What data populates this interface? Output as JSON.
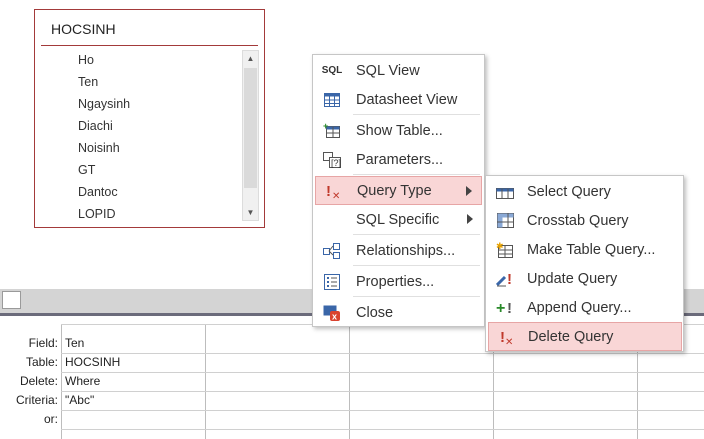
{
  "table": {
    "title": "HOCSINH",
    "fields": [
      "Ho",
      "Ten",
      "Ngaysinh",
      "Diachi",
      "Noisinh",
      "GT",
      "Dantoc",
      "LOPID"
    ]
  },
  "grid": {
    "row_labels": [
      "Field:",
      "Table:",
      "Delete:",
      "Criteria:",
      "or:"
    ],
    "column1": [
      "Ten",
      "HOCSINH",
      "Where",
      "\"Abc\"",
      ""
    ]
  },
  "context_menu": {
    "items": [
      {
        "label": "SQL View",
        "icon": "sql-icon"
      },
      {
        "label": "Datasheet View",
        "icon": "datasheet-icon"
      },
      {
        "label": "Show Table...",
        "icon": "show-table-icon"
      },
      {
        "label": "Parameters...",
        "icon": "parameters-icon"
      },
      {
        "label": "Query Type",
        "icon": "query-type-icon"
      },
      {
        "label": "SQL Specific",
        "icon": ""
      },
      {
        "label": "Relationships...",
        "icon": "relationships-icon"
      },
      {
        "label": "Properties...",
        "icon": "properties-icon"
      },
      {
        "label": "Close",
        "icon": "close-icon"
      }
    ]
  },
  "query_type_menu": {
    "items": [
      {
        "label": "Select Query",
        "icon": "select-query-icon"
      },
      {
        "label": "Crosstab Query",
        "icon": "crosstab-query-icon"
      },
      {
        "label": "Make Table Query...",
        "icon": "make-table-query-icon"
      },
      {
        "label": "Update Query",
        "icon": "update-query-icon"
      },
      {
        "label": "Append Query...",
        "icon": "append-query-icon"
      },
      {
        "label": "Delete Query",
        "icon": "delete-query-icon"
      }
    ]
  },
  "colors": {
    "table_border": "#a33a3a",
    "highlight_bg": "#f9d6d6",
    "highlight_border": "#e7a5a5"
  }
}
